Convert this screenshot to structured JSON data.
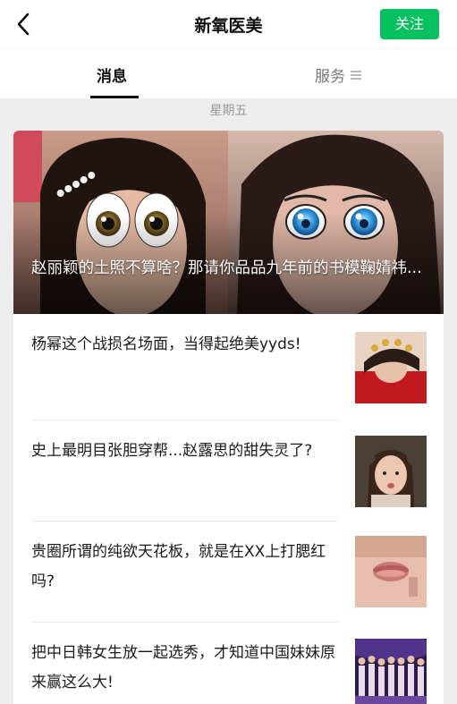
{
  "header": {
    "title": "新氧医美",
    "follow_label": "关注"
  },
  "tabs": [
    {
      "label": "消息"
    },
    {
      "label": "服务"
    }
  ],
  "weekday": "星期五",
  "hero": {
    "title": "赵丽颖的土照不算啥？那请你品品九年前的书模鞠婧祎..."
  },
  "articles": [
    {
      "title": "杨幂这个战损名场面，当得起绝美yyds!"
    },
    {
      "title": "史上最明目张胆穿帮...赵露思的甜失灵了?"
    },
    {
      "title": "贵圈所谓的纯欲天花板，就是在XX上打腮红吗?"
    },
    {
      "title": "把中日韩女生放一起选秀，才知道中国妹妹原来赢这么大!"
    }
  ],
  "colors": {
    "accent": "#07c160",
    "background": "#ededed"
  }
}
